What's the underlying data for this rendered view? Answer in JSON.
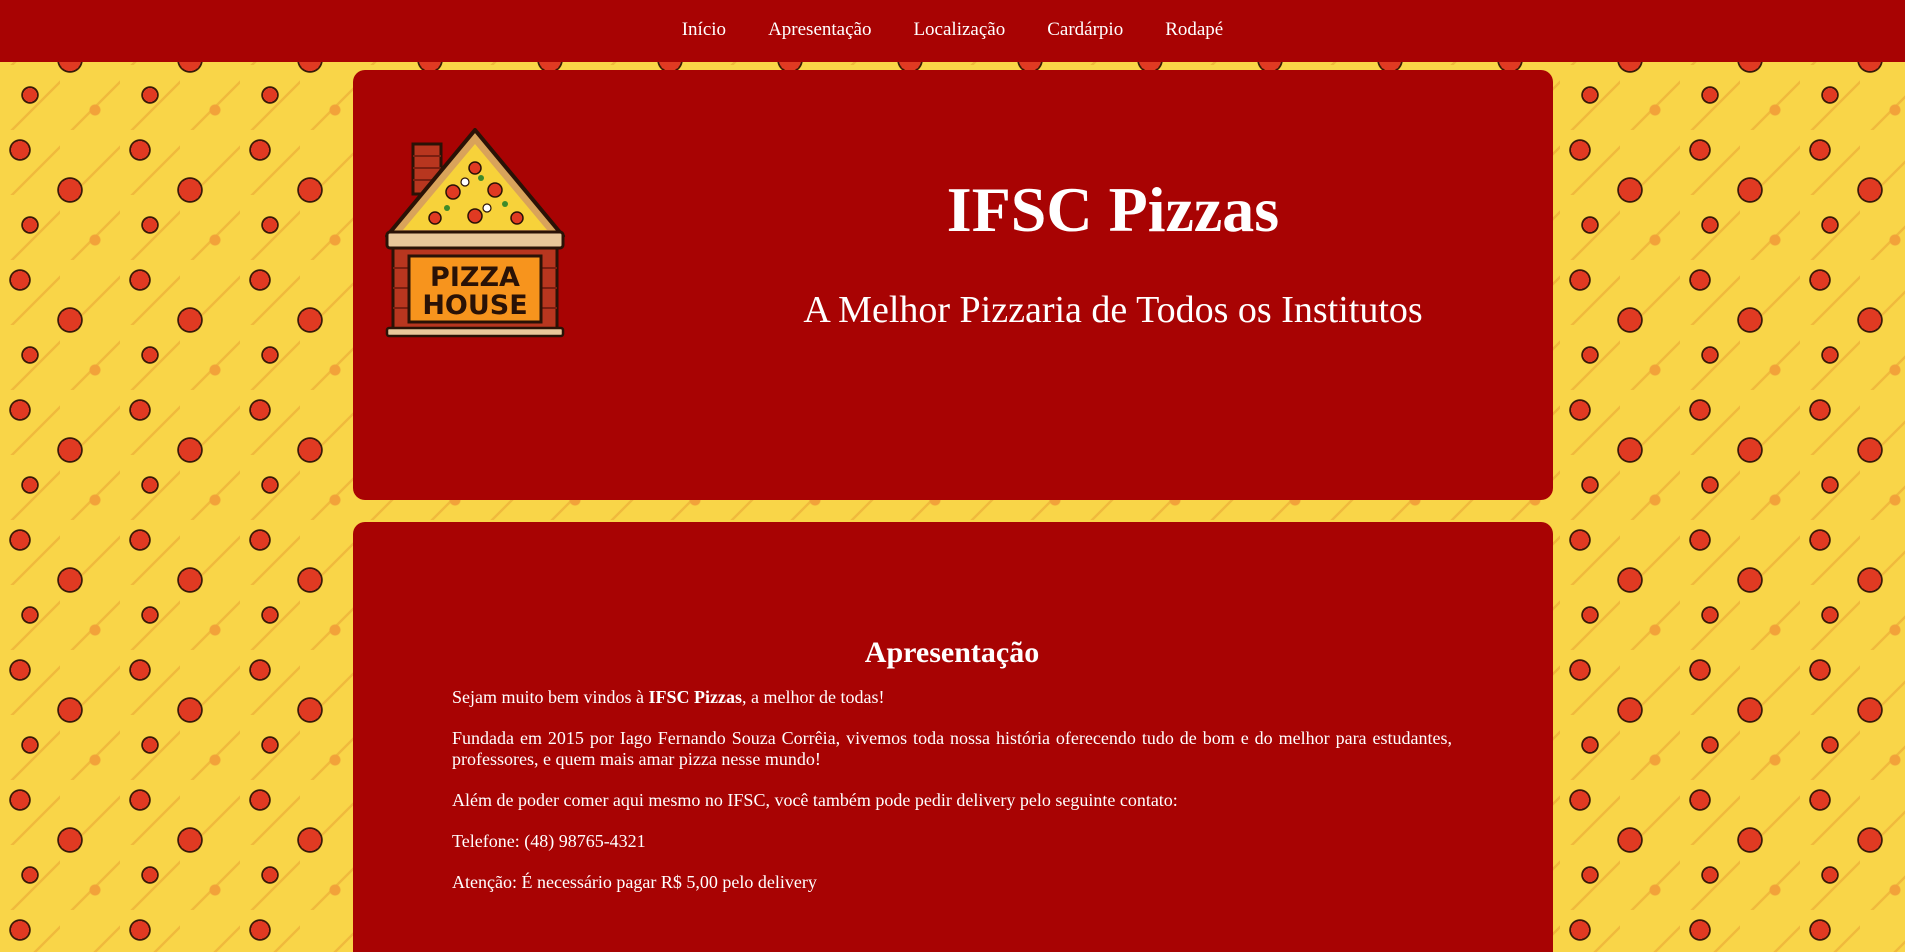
{
  "nav": {
    "items": [
      {
        "label": "Início"
      },
      {
        "label": "Apresentação"
      },
      {
        "label": "Localização"
      },
      {
        "label": "Cardárpio"
      },
      {
        "label": "Rodapé"
      }
    ]
  },
  "hero": {
    "logo": {
      "icon": "pizza-house-logo",
      "line1": "PIZZA",
      "line2": "HOUSE"
    },
    "title": "IFSC Pizzas",
    "subtitle": "A Melhor Pizzaria de Todos os Institutos"
  },
  "about": {
    "heading": "Apresentação",
    "welcome_prefix": "Sejam muito bem vindos à ",
    "welcome_brand": "IFSC Pizzas",
    "welcome_suffix": ", a melhor de todas!",
    "history": "Fundada em 2015 por Iago Fernando Souza Corrêia, vivemos toda nossa história oferecendo tudo de bom e do melhor para estudantes, professores, e quem mais amar pizza nesse mundo!",
    "delivery": "Além de poder comer aqui mesmo no IFSC, você também pode pedir delivery pelo seguinte contato:",
    "phone": "Telefone: (48) 98765-4321",
    "notice": "Atenção: É necessário pagar R$ 5,00 pelo delivery"
  },
  "colors": {
    "brand_red": "#a80303",
    "background_yellow": "#f9d548",
    "text": "#ffffff"
  }
}
